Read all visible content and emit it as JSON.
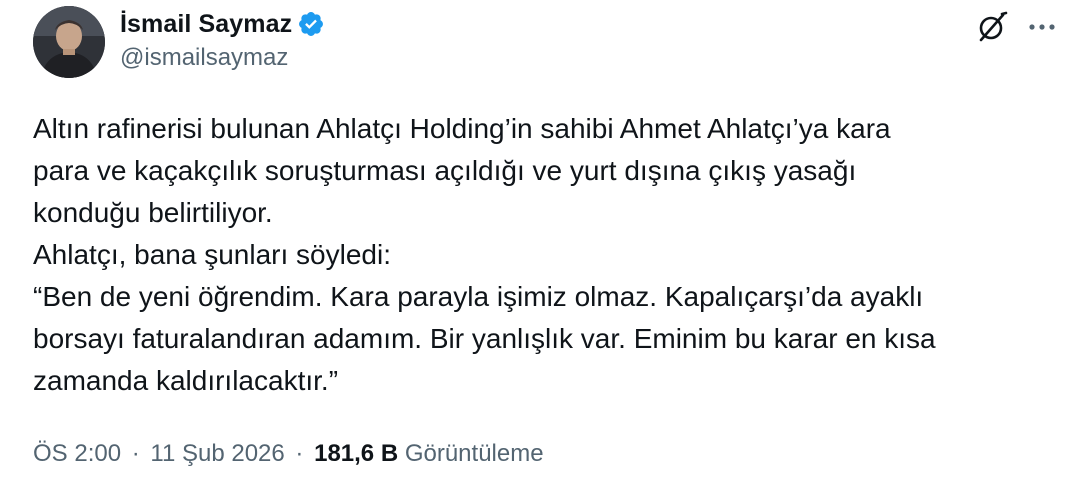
{
  "author": {
    "display_name": "İsmail Saymaz",
    "handle": "@ismailsaymaz",
    "verified": true,
    "verified_color": "#1d9bf0"
  },
  "toolbar": {
    "grok_icon": "grok-icon",
    "more_icon": "more-icon"
  },
  "tweet": {
    "lines": [
      "Altın rafinerisi bulunan Ahlatçı Holding’in sahibi Ahmet Ahlatçı’ya kara",
      "para ve kaçakçılık soruşturması açıldığı ve yurt dışına çıkış yasağı",
      "konduğu belirtiliyor.",
      "Ahlatçı, bana şunları söyledi:",
      "“Ben de yeni öğrendim. Kara parayla işimiz olmaz. Kapalıçarşı’da ayaklı",
      "borsayı faturalandıran adamım. Bir yanlışlık var. Eminim bu karar en kısa",
      "zamanda kaldırılacaktır.”"
    ]
  },
  "meta": {
    "time": "ÖS 2:00",
    "separator": "·",
    "date": "11 Şub 2026",
    "views_count": "181,6 B",
    "views_label": "Görüntüleme"
  }
}
